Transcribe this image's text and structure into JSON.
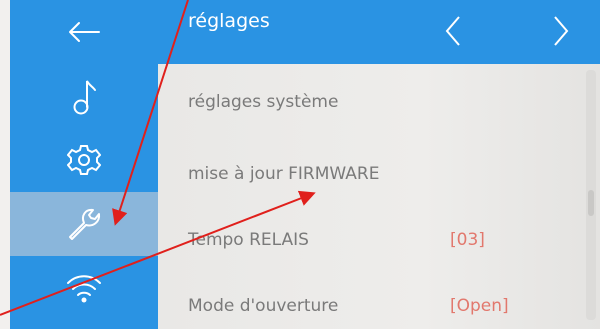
{
  "header": {
    "title": "réglages",
    "back_icon": "arrow-left-icon",
    "prev_icon": "chevron-left-icon",
    "next_icon": "chevron-right-icon"
  },
  "sidebar": {
    "items": [
      {
        "icon": "music-note-icon",
        "active": false
      },
      {
        "icon": "gear-icon",
        "active": false
      },
      {
        "icon": "wrench-icon",
        "active": true
      },
      {
        "icon": "wifi-icon",
        "active": false
      }
    ]
  },
  "settings": {
    "items": [
      {
        "label": "réglages système",
        "value": ""
      },
      {
        "label": "mise à jour FIRMWARE",
        "value": ""
      },
      {
        "label": "Tempo RELAIS",
        "value": "[03]"
      },
      {
        "label": "Mode d'ouverture",
        "value": "[Open]"
      }
    ]
  },
  "colors": {
    "accent": "#2a93e3",
    "active_sidebar": "#8ab6db",
    "value_text": "#e2786d",
    "annotation_arrow": "#e0201c"
  }
}
